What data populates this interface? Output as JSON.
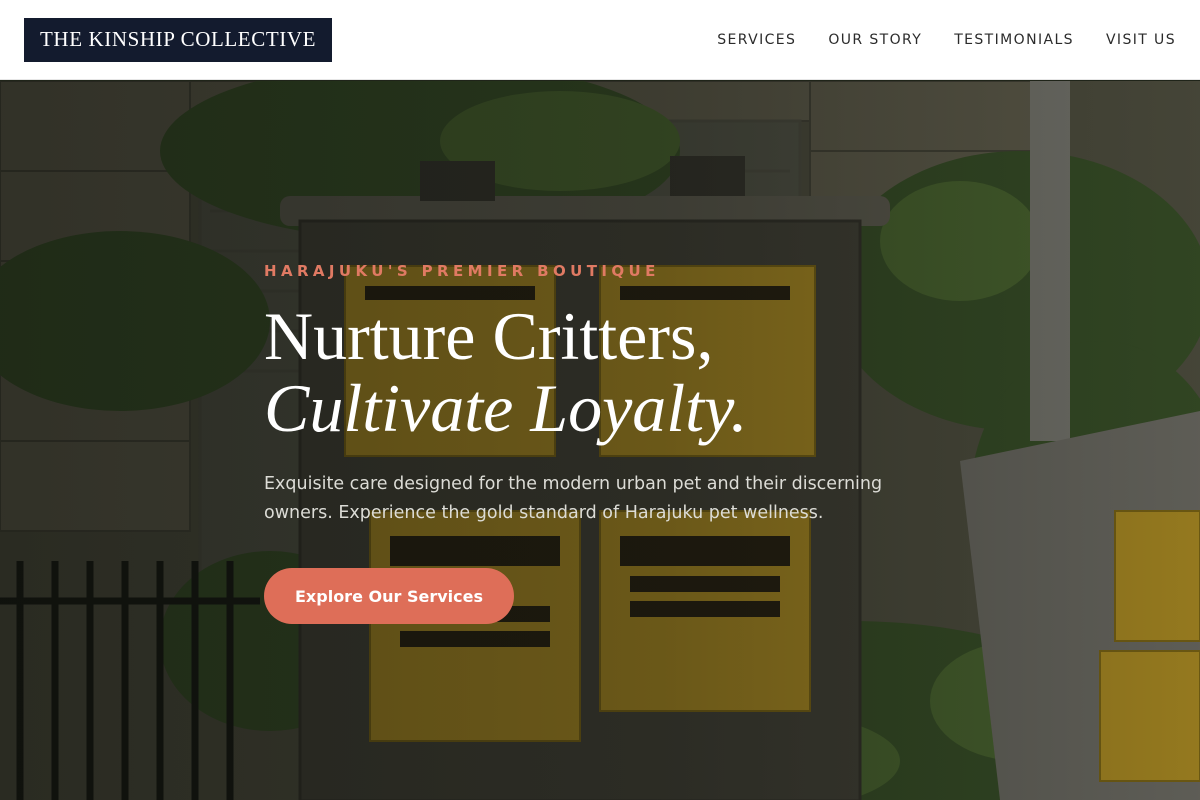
{
  "brand": {
    "logo_text": "THE KINSHIP COLLECTIVE"
  },
  "nav": {
    "items": [
      {
        "label": "SERVICES"
      },
      {
        "label": "OUR STORY"
      },
      {
        "label": "TESTIMONIALS"
      },
      {
        "label": "VISIT US"
      }
    ]
  },
  "hero": {
    "eyebrow": "HARAJUKU'S PREMIER BOUTIQUE",
    "headline_line1": "Nurture Critters,",
    "headline_line2": "Cultivate Loyalty.",
    "subtitle": "Exquisite care designed for the modern urban pet and their discerning owners. Experience the gold standard of Harajuku pet wellness.",
    "cta_label": "Explore Our Services"
  },
  "colors": {
    "header_bg": "#ffffff",
    "logo_bg": "#131b2e",
    "accent": "#de6e58",
    "eyebrow": "#e07a63",
    "overlay": "#0c0e0a"
  }
}
